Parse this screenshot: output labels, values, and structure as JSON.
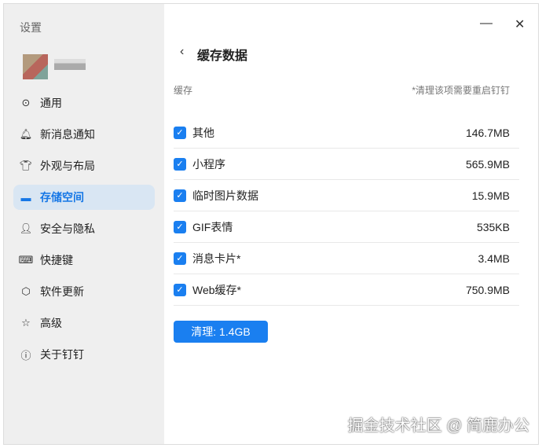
{
  "sidebar": {
    "title": "设置",
    "items": [
      {
        "label": "通用",
        "icon": "gear-icon",
        "glyph": "⊙"
      },
      {
        "label": "新消息通知",
        "icon": "bell-icon",
        "glyph": "🔔︎"
      },
      {
        "label": "外观与布局",
        "icon": "shirt-icon",
        "glyph": "👕︎"
      },
      {
        "label": "存储空间",
        "icon": "storage-icon",
        "glyph": "▬"
      },
      {
        "label": "安全与隐私",
        "icon": "user-icon",
        "glyph": "👤︎"
      },
      {
        "label": "快捷键",
        "icon": "keyboard-icon",
        "glyph": "⌨"
      },
      {
        "label": "软件更新",
        "icon": "cube-icon",
        "glyph": "⬡"
      },
      {
        "label": "高级",
        "icon": "star-icon",
        "glyph": "☆"
      },
      {
        "label": "关于钉钉",
        "icon": "info-icon",
        "glyph": "ⓘ"
      }
    ]
  },
  "window": {
    "minimize": "—",
    "close": "✕"
  },
  "page": {
    "back": "‹",
    "title": "缓存数据",
    "section": "缓存",
    "note": "*清理该项需要重启钉钉"
  },
  "cache": [
    {
      "label": "其他",
      "size": "146.7MB"
    },
    {
      "label": "小程序",
      "size": "565.9MB"
    },
    {
      "label": "临时图片数据",
      "size": "15.9MB"
    },
    {
      "label": "GIF表情",
      "size": "535KB"
    },
    {
      "label": "消息卡片*",
      "size": "3.4MB"
    },
    {
      "label": "Web缓存*",
      "size": "750.9MB"
    }
  ],
  "clean_button": "清理: 1.4GB",
  "watermark": "掘金技术社区 @ 简鹿办公"
}
